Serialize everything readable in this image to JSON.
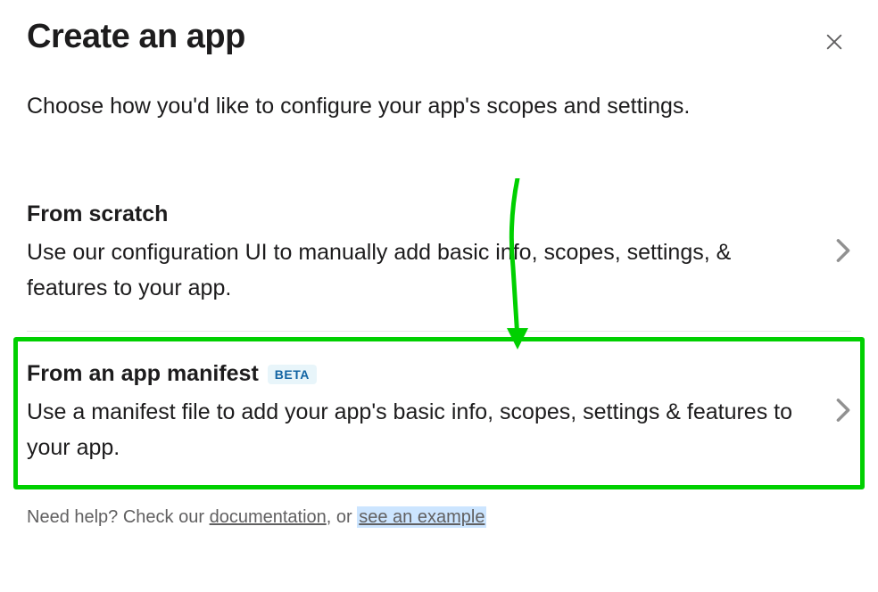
{
  "modal": {
    "title": "Create an app",
    "subtitle": "Choose how you'd like to configure your app's scopes and settings."
  },
  "options": {
    "fromScratch": {
      "title": "From scratch",
      "description": "Use our configuration UI to manually add basic info, scopes, settings, & features to your app."
    },
    "fromManifest": {
      "title": "From an app manifest",
      "badge": "BETA",
      "description": "Use a manifest file to add your app's basic info, scopes, settings & features to your app."
    }
  },
  "help": {
    "prefix": "Need help? Check our ",
    "docLink": "documentation",
    "middle": ", or ",
    "exampleLink": "see an example"
  }
}
